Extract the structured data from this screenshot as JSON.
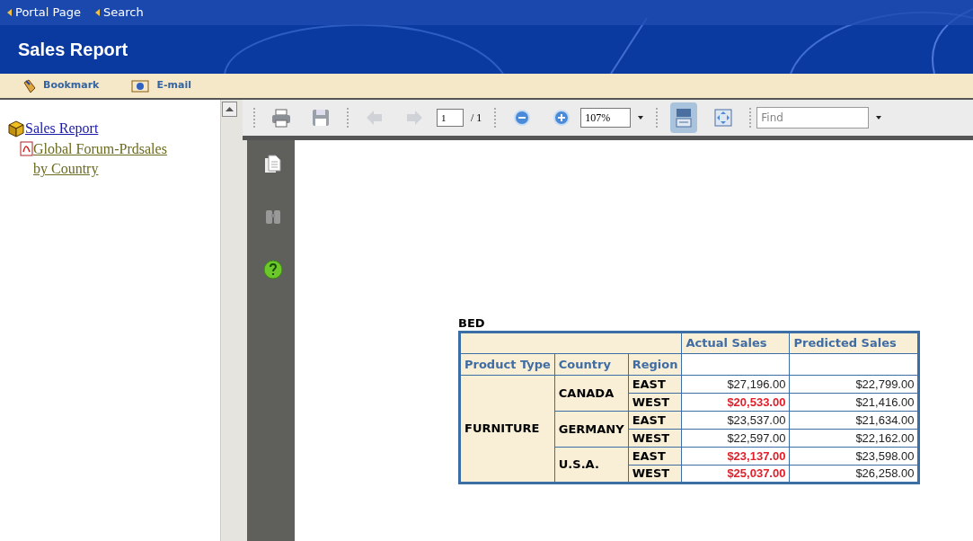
{
  "nav_links": [
    "Portal Page",
    "Search"
  ],
  "title": "Sales Report",
  "actions": [
    {
      "label": "Bookmark",
      "kind": "bookmark"
    },
    {
      "label": "E-mail",
      "kind": "email"
    }
  ],
  "tree": {
    "label": "Sales Report",
    "children": [
      {
        "label": "Global Forum-Prdsales by Country"
      }
    ]
  },
  "toolbar": {
    "page": "1",
    "page_total": "/ 1",
    "zoom": "107%",
    "fit_width_selected": true,
    "find_placeholder": "Find"
  },
  "report": {
    "title": "BED",
    "columns": [
      "Product Type",
      "Country",
      "Region",
      "Actual Sales",
      "Predicted Sales"
    ],
    "groups": [
      {
        "product_type": "FURNITURE",
        "countries": [
          {
            "country": "CANADA",
            "regions": [
              {
                "region": "EAST",
                "actual": "$27,196.00",
                "flagged": false,
                "predicted": "$22,799.00"
              },
              {
                "region": "WEST",
                "actual": "$20,533.00",
                "flagged": true,
                "predicted": "$21,416.00"
              }
            ]
          },
          {
            "country": "GERMANY",
            "regions": [
              {
                "region": "EAST",
                "actual": "$23,537.00",
                "flagged": false,
                "predicted": "$21,634.00"
              },
              {
                "region": "WEST",
                "actual": "$22,597.00",
                "flagged": false,
                "predicted": "$22,162.00"
              }
            ]
          },
          {
            "country": "U.S.A.",
            "regions": [
              {
                "region": "EAST",
                "actual": "$23,137.00",
                "flagged": true,
                "predicted": "$23,598.00"
              },
              {
                "region": "WEST",
                "actual": "$25,037.00",
                "flagged": true,
                "predicted": "$26,258.00"
              }
            ]
          }
        ]
      }
    ]
  }
}
